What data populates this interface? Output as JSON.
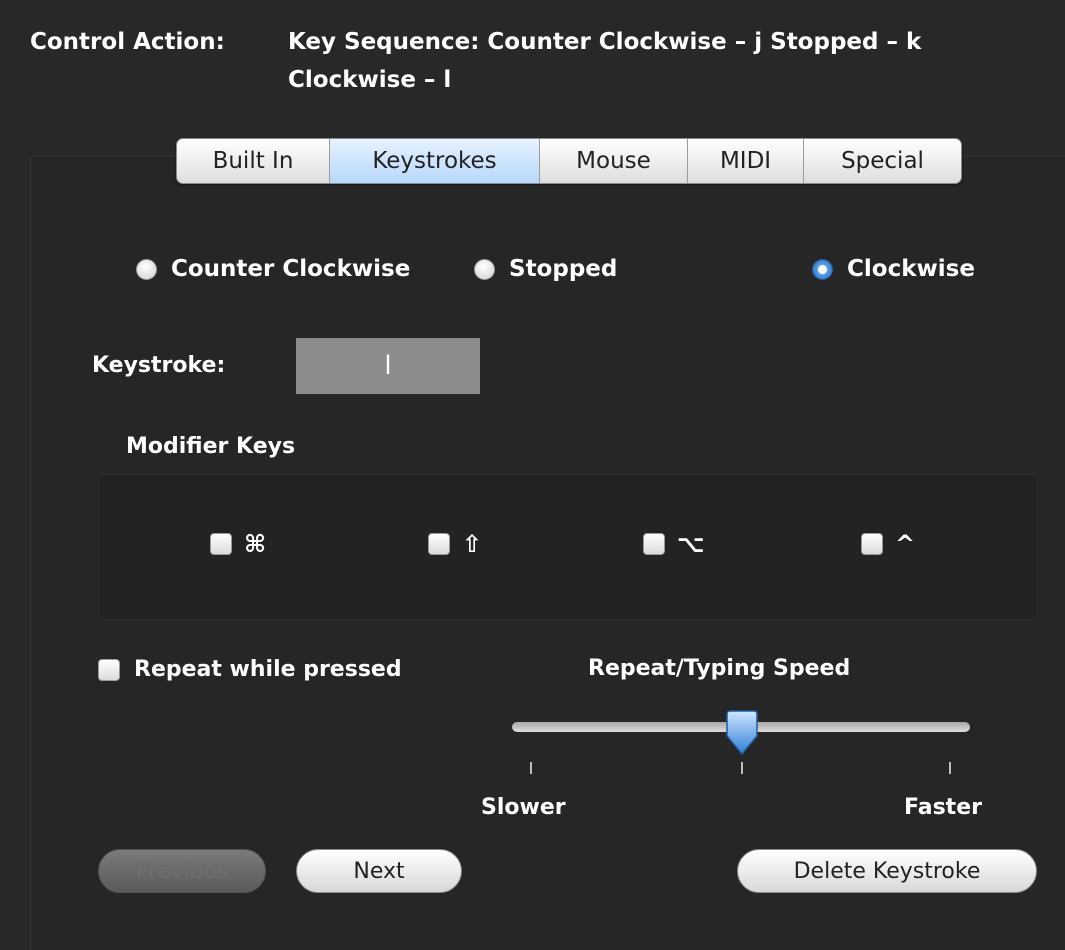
{
  "header": {
    "control_action_label": "Control Action:",
    "sequence_line1": "Key Sequence:  Counter Clockwise – j  Stopped – k",
    "sequence_line2": "Clockwise – l"
  },
  "tabs": [
    {
      "label": "Built In",
      "selected": false
    },
    {
      "label": "Keystrokes",
      "selected": true
    },
    {
      "label": "Mouse",
      "selected": false
    },
    {
      "label": "MIDI",
      "selected": false
    },
    {
      "label": "Special",
      "selected": false
    }
  ],
  "directions": [
    {
      "label": "Counter Clockwise",
      "selected": false
    },
    {
      "label": "Stopped",
      "selected": false
    },
    {
      "label": "Clockwise",
      "selected": true
    }
  ],
  "keystroke": {
    "label": "Keystroke:",
    "value": "l"
  },
  "modifiers": {
    "title": "Modifier Keys",
    "items": [
      {
        "glyph": "⌘",
        "checked": false,
        "icon": "command-icon"
      },
      {
        "glyph": "⇧",
        "checked": false,
        "icon": "shift-icon"
      },
      {
        "glyph": "⌥",
        "checked": false,
        "icon": "option-icon"
      },
      {
        "glyph": "^",
        "checked": false,
        "icon": "control-icon"
      }
    ]
  },
  "repeat": {
    "label": "Repeat while pressed",
    "checked": false
  },
  "speed": {
    "title": "Repeat/Typing Speed",
    "slower_label": "Slower",
    "faster_label": "Faster",
    "value_fraction": 0.5
  },
  "buttons": {
    "previous_label": "Previous",
    "next_label": "Next",
    "delete_label": "Delete Keystroke"
  },
  "colors": {
    "background": "#282828",
    "selected_tab": "#b7d8fb",
    "radio_selected": "#2b72c6"
  }
}
